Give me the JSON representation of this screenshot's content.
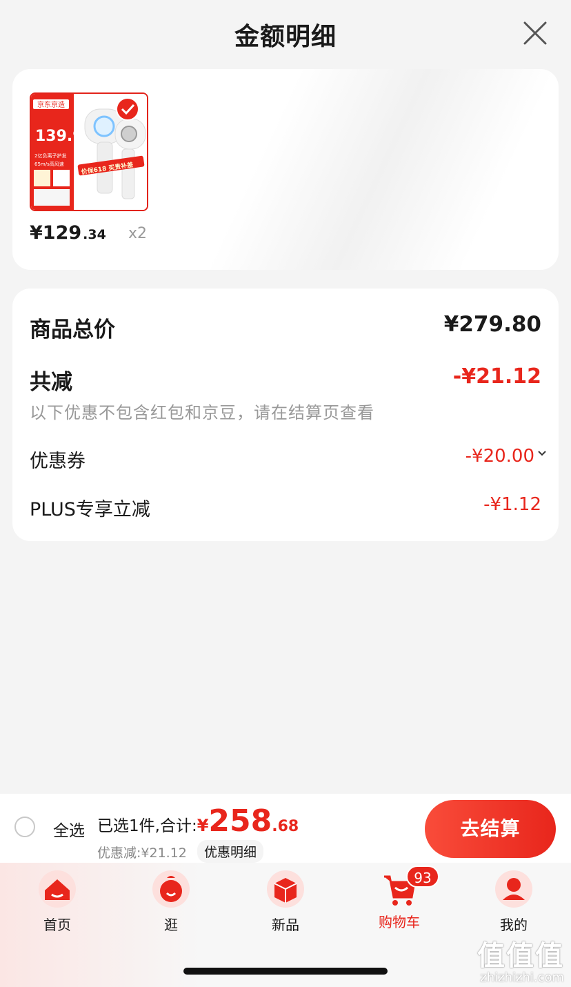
{
  "header": {
    "title": "金额明细"
  },
  "product": {
    "price_main": "¥129",
    "price_decimal": ".34",
    "quantity": "x2",
    "image": {
      "brand_text": "京东京造",
      "promo_price": "139.9",
      "promo_tag": "价保618 买贵补差",
      "feature1": "2亿负离子护发",
      "feature2": "65m/s高风速",
      "sticker": "618"
    }
  },
  "details": {
    "total_label": "商品总价",
    "total_value": "¥279.80",
    "reduce_label": "共减",
    "reduce_value": "-¥21.12",
    "note": "以下优惠不包含红包和京豆，请在结算页查看",
    "coupon_label": "优惠券",
    "coupon_value": "-¥20.00",
    "plus_label": "PLUS专享立减",
    "plus_value": "-¥1.12"
  },
  "checkout": {
    "select_all": "全选",
    "selected_text": "已选1件,合计:",
    "currency": "¥",
    "amount": "258",
    "amount_decimal": ".68",
    "discount_text": "优惠减:¥21.12",
    "discount_link": "优惠明细",
    "pay_button": "去结算"
  },
  "tabs": [
    {
      "label": "首页",
      "icon": "home-icon"
    },
    {
      "label": "逛",
      "icon": "browse-icon"
    },
    {
      "label": "新品",
      "icon": "new-products-icon"
    },
    {
      "label": "购物车",
      "icon": "cart-icon",
      "badge": "93",
      "active": true
    },
    {
      "label": "我的",
      "icon": "profile-icon"
    }
  ],
  "watermark": {
    "main": "值值值",
    "sub": "zhizhizhi.com"
  },
  "colors": {
    "accent": "#e8261c",
    "background": "#f4f4f4"
  }
}
